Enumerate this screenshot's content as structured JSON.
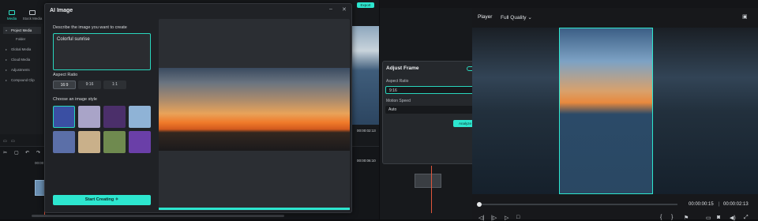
{
  "left_app": {
    "tabs": [
      {
        "label": "Media",
        "active": true
      },
      {
        "label": "Stock Media",
        "active": false
      }
    ],
    "sidebar": [
      {
        "label": "Project Media",
        "active": true
      },
      {
        "label": "Folder",
        "active": false
      },
      {
        "label": "Global Media",
        "active": false
      },
      {
        "label": "Cloud Media",
        "active": false
      },
      {
        "label": "Adjustments",
        "active": false
      },
      {
        "label": "Compound Clip",
        "active": false
      }
    ],
    "timecode_a": "00:00:02:13",
    "timecode_b": "00:00:06:10",
    "export_label": "Export",
    "ruler_time": "00:00"
  },
  "dialog": {
    "title": "AI Image",
    "prompt_label": "Describe the image you want to create",
    "prompt_value": "Colorful sunrise",
    "aspect_label": "Aspect Ratio",
    "aspect_options": [
      "16:9",
      "9:16",
      "1:1"
    ],
    "aspect_selected": "16:9",
    "style_label": "Choose an image style",
    "style_thumb_colors": [
      "#3a4fa3",
      "#a9a4c8",
      "#4b2f6a",
      "#8fb3d6",
      "#5b6fa8",
      "#c9b08a",
      "#6f8a4f",
      "#6a3fa8"
    ],
    "start_button": "Start Creating"
  },
  "right_app": {
    "adjust_frame": {
      "title": "Adjust Frame",
      "aspect_label": "Aspect Ratio",
      "aspect_value": "9:16",
      "speed_label": "Motion Speed",
      "speed_value": "Auto",
      "analyze_button": "Analyze"
    },
    "player": {
      "title": "Player",
      "quality": "Full Quality",
      "current_time": "00:00:00:15",
      "total_time": "00:00:02:13"
    }
  },
  "colors": {
    "accent": "#2de6cf",
    "panel": "#202226",
    "background": "#141518"
  }
}
